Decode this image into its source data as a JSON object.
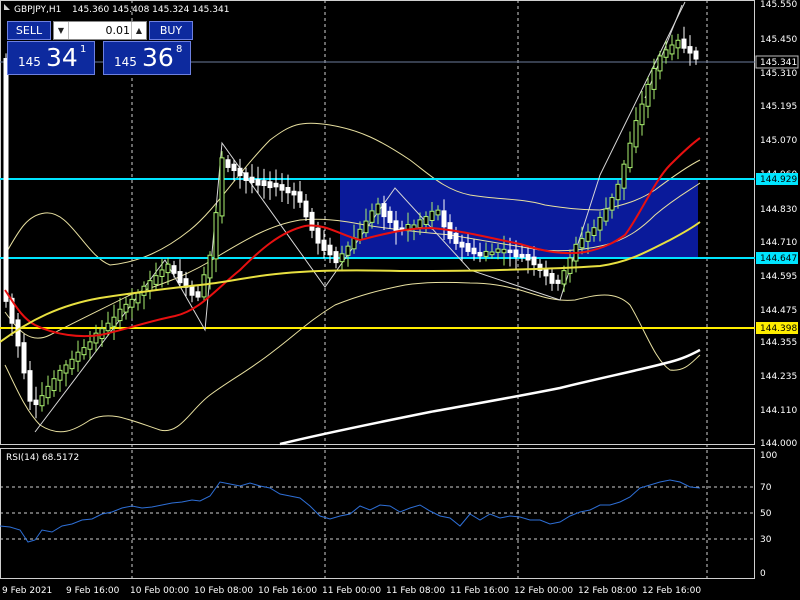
{
  "header": {
    "symbol": "GBPJPY,H1",
    "ohlc": "145.360 145.408 145.324 145.341"
  },
  "trade_panel": {
    "sell_label": "SELL",
    "buy_label": "BUY",
    "lot": "0.01",
    "sell_small": "145",
    "sell_big": "34",
    "sell_sup": "1",
    "buy_small": "145",
    "buy_big": "36",
    "buy_sup": "8"
  },
  "price_axis": [
    "145.550",
    "145.450",
    "145.310",
    "145.195",
    "145.070",
    "144.960",
    "144.830",
    "144.710",
    "144.595",
    "144.475",
    "144.355",
    "144.235",
    "144.110",
    "144.000"
  ],
  "price_labels": {
    "current": "145.341",
    "hline_top": "144.929",
    "hline_mid": "144.647",
    "hline_low": "144.398"
  },
  "indicator": {
    "label": "RSI(14) 68.5172",
    "levels": [
      "100",
      "70",
      "50",
      "30",
      "0"
    ]
  },
  "time_axis": [
    "9 Feb 2021",
    "9 Feb 16:00",
    "10 Feb 00:00",
    "10 Feb 08:00",
    "10 Feb 16:00",
    "11 Feb 00:00",
    "11 Feb 08:00",
    "11 Feb 16:00",
    "12 Feb 00:00",
    "12 Feb 08:00",
    "12 Feb 16:00"
  ],
  "colors": {
    "hline": "#00e5ff",
    "hline_low": "#ffee00",
    "rect_fill": "#0a1a9a",
    "ma_red": "#e81010",
    "ma_yellow": "#e8e040",
    "ma_white": "#ffffff",
    "bands": "#e8e0a0",
    "rsi_line": "#2e6fd6",
    "candle_up": "#aaf070",
    "candle_down": "#ffffff"
  }
}
